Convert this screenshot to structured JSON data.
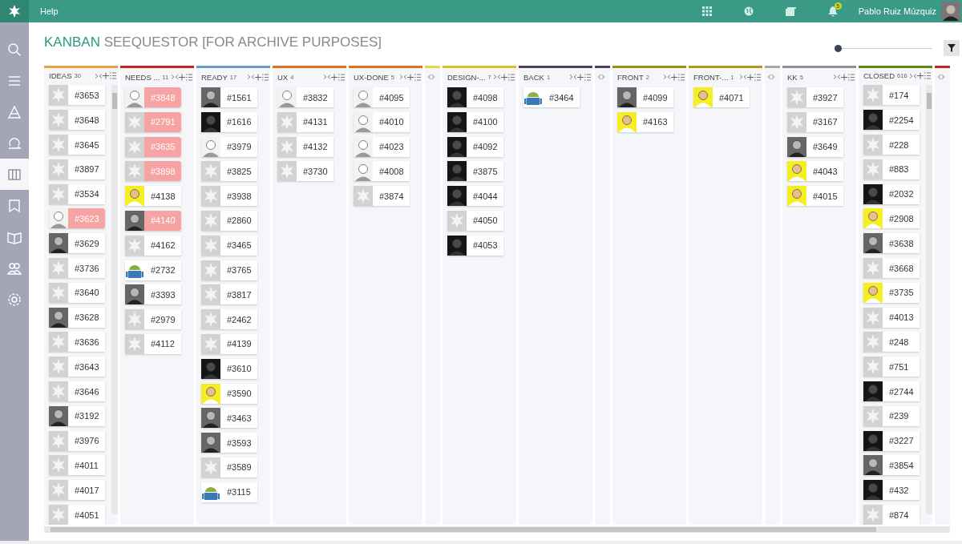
{
  "topbar": {
    "menu": "Help",
    "notifications": "5",
    "user": "Pablo Ruiz Múzquiz"
  },
  "sidebar": {
    "items": [
      {
        "kind": "search",
        "selected": false
      },
      {
        "kind": "menu",
        "selected": false
      },
      {
        "kind": "triangle",
        "selected": false
      },
      {
        "kind": "loop",
        "selected": false
      },
      {
        "kind": "columns",
        "selected": true
      },
      {
        "kind": "bookmark",
        "selected": false
      },
      {
        "kind": "book",
        "selected": false
      },
      {
        "kind": "people",
        "selected": false
      },
      {
        "kind": "settings",
        "selected": false
      }
    ]
  },
  "title": {
    "section": "KANBAN",
    "project": "SEEQUESTOR [FOR ARCHIVE PURPOSES]"
  },
  "zoom_slider": {
    "level": 0
  },
  "columns": [
    {
      "kind": "open",
      "name": "IDEAS",
      "count": "30",
      "color": "#e8a040",
      "scrollbar": true,
      "cards": [
        {
          "number": "#3653",
          "kind": "generic",
          "flagged": false
        },
        {
          "number": "#3648",
          "kind": "generic",
          "flagged": false
        },
        {
          "number": "#3645",
          "kind": "generic",
          "flagged": false
        },
        {
          "number": "#3897",
          "kind": "generic",
          "flagged": false
        },
        {
          "number": "#3534",
          "kind": "generic",
          "flagged": false
        },
        {
          "number": "#3623",
          "kind": "sketch",
          "flagged": true
        },
        {
          "number": "#3629",
          "kind": "photo",
          "flagged": false
        },
        {
          "number": "#3736",
          "kind": "generic",
          "flagged": false
        },
        {
          "number": "#3640",
          "kind": "generic",
          "flagged": false
        },
        {
          "number": "#3628",
          "kind": "photo",
          "flagged": false
        },
        {
          "number": "#3636",
          "kind": "generic",
          "flagged": false
        },
        {
          "number": "#3643",
          "kind": "generic",
          "flagged": false
        },
        {
          "number": "#3646",
          "kind": "generic",
          "flagged": false
        },
        {
          "number": "#3192",
          "kind": "photo",
          "flagged": false
        },
        {
          "number": "#3976",
          "kind": "generic",
          "flagged": false
        },
        {
          "number": "#4011",
          "kind": "generic",
          "flagged": false
        },
        {
          "number": "#4017",
          "kind": "generic",
          "flagged": false
        },
        {
          "number": "#4051",
          "kind": "generic",
          "flagged": false
        }
      ]
    },
    {
      "kind": "open",
      "name": "NEEDS ...",
      "count": "11",
      "color": "#cc2222",
      "scrollbar": false,
      "cards": [
        {
          "number": "#3848",
          "kind": "sketch",
          "flagged": true
        },
        {
          "number": "#2791",
          "kind": "generic",
          "flagged": true
        },
        {
          "number": "#3635",
          "kind": "generic",
          "flagged": true
        },
        {
          "number": "#3898",
          "kind": "generic",
          "flagged": true
        },
        {
          "number": "#4138",
          "kind": "yellow",
          "flagged": false
        },
        {
          "number": "#4140",
          "kind": "photo",
          "flagged": true
        },
        {
          "number": "#4162",
          "kind": "generic",
          "flagged": false
        },
        {
          "number": "#2732",
          "kind": "android",
          "flagged": false
        },
        {
          "number": "#3393",
          "kind": "photo",
          "flagged": false
        },
        {
          "number": "#2979",
          "kind": "generic",
          "flagged": false
        },
        {
          "number": "#4112",
          "kind": "generic",
          "flagged": false
        }
      ]
    },
    {
      "kind": "open",
      "name": "READY",
      "count": "17",
      "color": "#6a9ad0",
      "scrollbar": false,
      "cards": [
        {
          "number": "#1561",
          "kind": "photo",
          "flagged": false
        },
        {
          "number": "#1616",
          "kind": "dark",
          "flagged": false
        },
        {
          "number": "#3979",
          "kind": "sketch",
          "flagged": false
        },
        {
          "number": "#3825",
          "kind": "generic",
          "flagged": false
        },
        {
          "number": "#3938",
          "kind": "generic",
          "flagged": false
        },
        {
          "number": "#2860",
          "kind": "generic",
          "flagged": false
        },
        {
          "number": "#3465",
          "kind": "generic",
          "flagged": false
        },
        {
          "number": "#3765",
          "kind": "generic",
          "flagged": false
        },
        {
          "number": "#3817",
          "kind": "generic",
          "flagged": false
        },
        {
          "number": "#2462",
          "kind": "generic",
          "flagged": false
        },
        {
          "number": "#4139",
          "kind": "generic",
          "flagged": false
        },
        {
          "number": "#3610",
          "kind": "dark",
          "flagged": false
        },
        {
          "number": "#3590",
          "kind": "yellow",
          "flagged": false
        },
        {
          "number": "#3463",
          "kind": "photo",
          "flagged": false
        },
        {
          "number": "#3593",
          "kind": "photo",
          "flagged": false
        },
        {
          "number": "#3589",
          "kind": "generic",
          "flagged": false
        },
        {
          "number": "#3115",
          "kind": "android",
          "flagged": false
        }
      ]
    },
    {
      "kind": "open",
      "name": "UX",
      "count": "4",
      "color": "#e07020",
      "scrollbar": false,
      "cards": [
        {
          "number": "#3832",
          "kind": "sketch",
          "flagged": false
        },
        {
          "number": "#4131",
          "kind": "generic",
          "flagged": false
        },
        {
          "number": "#4132",
          "kind": "generic",
          "flagged": false
        },
        {
          "number": "#3730",
          "kind": "generic",
          "flagged": false
        }
      ]
    },
    {
      "kind": "open",
      "name": "UX-DONE",
      "count": "5",
      "color": "#e07020",
      "scrollbar": false,
      "cards": [
        {
          "number": "#4095",
          "kind": "sketch",
          "flagged": false
        },
        {
          "number": "#4010",
          "kind": "sketch",
          "flagged": false
        },
        {
          "number": "#4023",
          "kind": "sketch",
          "flagged": false
        },
        {
          "number": "#4008",
          "kind": "sketch",
          "flagged": false
        },
        {
          "number": "#3874",
          "kind": "generic",
          "flagged": false
        }
      ]
    },
    {
      "kind": "collapsed",
      "color": "#e8d840"
    },
    {
      "kind": "open",
      "name": "DESIGN-...",
      "count": "7",
      "color": "#e0c020",
      "scrollbar": false,
      "cards": [
        {
          "number": "#4098",
          "kind": "dark",
          "flagged": false
        },
        {
          "number": "#4100",
          "kind": "dark",
          "flagged": false
        },
        {
          "number": "#4092",
          "kind": "dark",
          "flagged": false
        },
        {
          "number": "#3875",
          "kind": "dark",
          "flagged": false
        },
        {
          "number": "#4044",
          "kind": "dark",
          "flagged": false
        },
        {
          "number": "#4050",
          "kind": "generic",
          "flagged": false
        },
        {
          "number": "#4053",
          "kind": "dark",
          "flagged": false
        }
      ]
    },
    {
      "kind": "open",
      "name": "BACK",
      "count": "1",
      "color": "#504060",
      "scrollbar": false,
      "cards": [
        {
          "number": "#3464",
          "kind": "android",
          "flagged": false
        }
      ]
    },
    {
      "kind": "collapsed",
      "color": "#504060"
    },
    {
      "kind": "open",
      "name": "FRONT",
      "count": "2",
      "color": "#a09010",
      "scrollbar": false,
      "cards": [
        {
          "number": "#4099",
          "kind": "photo",
          "flagged": false
        },
        {
          "number": "#4163",
          "kind": "yellow",
          "flagged": false
        }
      ]
    },
    {
      "kind": "open",
      "name": "FRONT-...",
      "count": "1",
      "color": "#b09a10",
      "scrollbar": false,
      "cards": [
        {
          "number": "#4071",
          "kind": "yellow",
          "flagged": false
        }
      ]
    },
    {
      "kind": "collapsed",
      "color": "#a8a8a8"
    },
    {
      "kind": "open",
      "name": "KK",
      "count": "5",
      "color": "#909090",
      "scrollbar": false,
      "cards": [
        {
          "number": "#3927",
          "kind": "generic",
          "flagged": false
        },
        {
          "number": "#3167",
          "kind": "generic",
          "flagged": false
        },
        {
          "number": "#3649",
          "kind": "photo",
          "flagged": false
        },
        {
          "number": "#4043",
          "kind": "yellow",
          "flagged": false
        },
        {
          "number": "#4015",
          "kind": "yellow",
          "flagged": false
        }
      ]
    },
    {
      "kind": "open",
      "name": "CLOSED",
      "count": "616",
      "color": "#5a8a10",
      "scrollbar": true,
      "cards": [
        {
          "number": "#174",
          "kind": "generic",
          "flagged": false
        },
        {
          "number": "#2254",
          "kind": "dark",
          "flagged": false
        },
        {
          "number": "#228",
          "kind": "generic",
          "flagged": false
        },
        {
          "number": "#883",
          "kind": "generic",
          "flagged": false
        },
        {
          "number": "#2032",
          "kind": "dark",
          "flagged": false
        },
        {
          "number": "#2908",
          "kind": "yellow",
          "flagged": false
        },
        {
          "number": "#3638",
          "kind": "photo",
          "flagged": false
        },
        {
          "number": "#3668",
          "kind": "generic",
          "flagged": false
        },
        {
          "number": "#3735",
          "kind": "yellow",
          "flagged": false
        },
        {
          "number": "#4013",
          "kind": "generic",
          "flagged": false
        },
        {
          "number": "#248",
          "kind": "generic",
          "flagged": false
        },
        {
          "number": "#751",
          "kind": "generic",
          "flagged": false
        },
        {
          "number": "#2744",
          "kind": "dark",
          "flagged": false
        },
        {
          "number": "#239",
          "kind": "generic",
          "flagged": false
        },
        {
          "number": "#3227",
          "kind": "dark",
          "flagged": false
        },
        {
          "number": "#3854",
          "kind": "photo",
          "flagged": false
        },
        {
          "number": "#432",
          "kind": "dark",
          "flagged": false
        },
        {
          "number": "#874",
          "kind": "generic",
          "flagged": false
        }
      ]
    },
    {
      "kind": "collapsed",
      "color": "#cc2222"
    }
  ]
}
